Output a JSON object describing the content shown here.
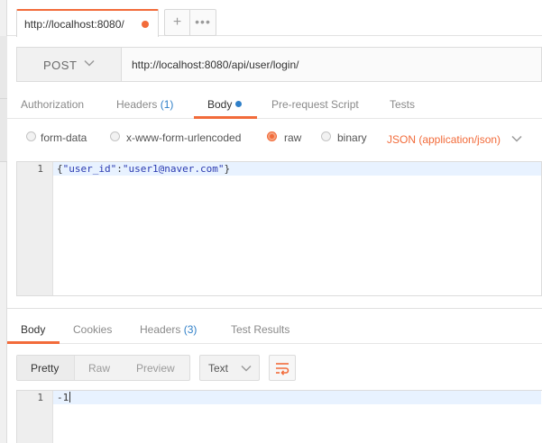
{
  "tab": {
    "title": "http://localhost:8080/",
    "add_label": "+",
    "more_label": "•••"
  },
  "request": {
    "method": "POST",
    "url": "http://localhost:8080/api/user/login/"
  },
  "request_tabs": [
    {
      "label": "Authorization"
    },
    {
      "label": "Headers",
      "count": "(1)"
    },
    {
      "label": "Body"
    },
    {
      "label": "Pre-request Script"
    },
    {
      "label": "Tests"
    }
  ],
  "body_modes": [
    {
      "label": "form-data"
    },
    {
      "label": "x-www-form-urlencoded"
    },
    {
      "label": "raw"
    },
    {
      "label": "binary"
    }
  ],
  "content_type": "JSON (application/json)",
  "request_body": {
    "line_number": "1",
    "open": "{",
    "key": "\"user_id\"",
    "colon": ":",
    "value": "\"user1@naver.com\"",
    "close": "}"
  },
  "response_tabs": [
    {
      "label": "Body"
    },
    {
      "label": "Cookies"
    },
    {
      "label": "Headers",
      "count": "(3)"
    },
    {
      "label": "Test Results"
    }
  ],
  "view_modes": [
    {
      "label": "Pretty"
    },
    {
      "label": "Raw"
    },
    {
      "label": "Preview"
    }
  ],
  "format_select": "Text",
  "response_body": {
    "line_number": "1",
    "content": "-1"
  },
  "colors": {
    "accent": "#f26b3a",
    "link_blue": "#2f7fc8"
  }
}
